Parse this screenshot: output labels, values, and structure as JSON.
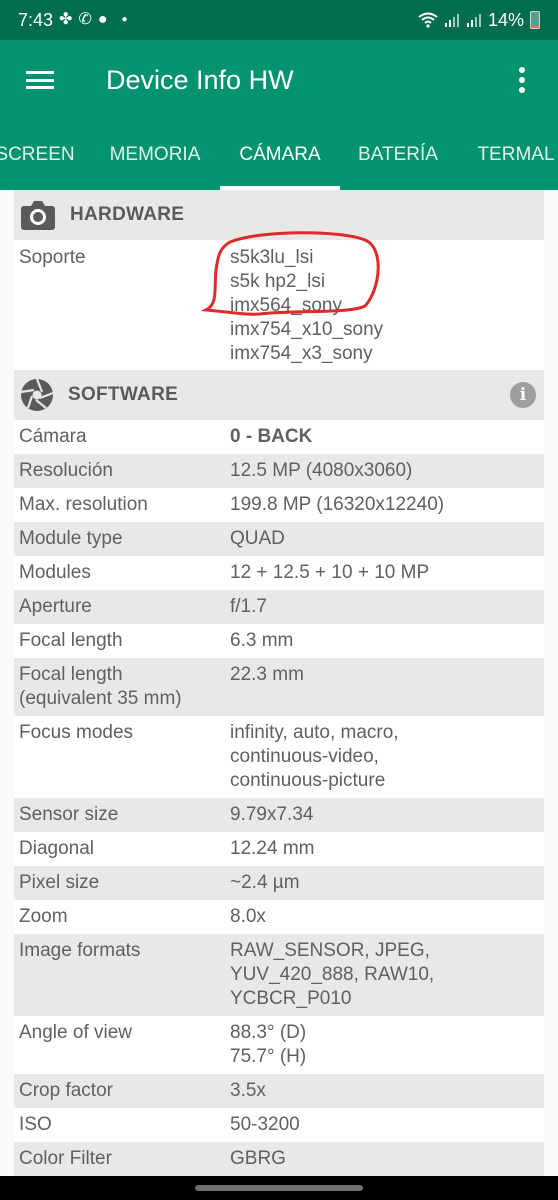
{
  "status_bar": {
    "time": "7:43",
    "notification_icons": [
      "pinwheel-icon",
      "whatsapp-icon",
      "bulb-icon",
      "dot-icon"
    ],
    "system_icons": [
      "wifi-icon",
      "signal-icon",
      "signal-icon"
    ],
    "battery_percent_text": "14%",
    "battery_level": 0.14
  },
  "app_bar": {
    "title": "Device Info HW",
    "menu_icon": "hamburger-menu-icon",
    "overflow_icon": "more-vert-icon"
  },
  "tabs": [
    {
      "label": "SCREEN",
      "active": false
    },
    {
      "label": "MEMORIA",
      "active": false
    },
    {
      "label": "CÁMARA",
      "active": true
    },
    {
      "label": "BATERÍA",
      "active": false
    },
    {
      "label": "TERMAL",
      "active": false
    }
  ],
  "hardware": {
    "header": "HARDWARE",
    "icon": "camera-icon",
    "rows": [
      {
        "key": "Soporte",
        "value": "s5k3lu_lsi\ns5k hp2_lsi\nimx564_sony\nimx754_x10_sony\nimx754_x3_sony"
      }
    ],
    "annotation": "red hand-drawn circle around first three sensor entries"
  },
  "software": {
    "header": "SOFTWARE",
    "icon": "aperture-icon",
    "info_icon": "info-icon",
    "rows": [
      {
        "key": "Cámara",
        "value": "0 - BACK",
        "bold": true
      },
      {
        "key": "Resolución",
        "value": "12.5 MP (4080x3060)"
      },
      {
        "key": "Max. resolution",
        "value": "199.8 MP (16320x12240)"
      },
      {
        "key": "Module type",
        "value": "QUAD"
      },
      {
        "key": "Modules",
        "value": "12 + 12.5 + 10 + 10 MP"
      },
      {
        "key": "Aperture",
        "value": "f/1.7"
      },
      {
        "key": "Focal length",
        "value": "6.3 mm"
      },
      {
        "key": "Focal length\n(equivalent 35 mm)",
        "value": "22.3 mm"
      },
      {
        "key": "Focus modes",
        "value": "infinity, auto, macro,\ncontinuous-video,\ncontinuous-picture"
      },
      {
        "key": "Sensor size",
        "value": "9.79x7.34"
      },
      {
        "key": "Diagonal",
        "value": "12.24 mm"
      },
      {
        "key": "Pixel size",
        "value": "~2.4 µm"
      },
      {
        "key": "Zoom",
        "value": "8.0x"
      },
      {
        "key": "Image formats",
        "value": "RAW_SENSOR, JPEG,\nYUV_420_888, RAW10,\nYCBCR_P010"
      },
      {
        "key": "Angle of view",
        "value": "88.3° (D)\n75.7° (H)"
      },
      {
        "key": "Crop factor",
        "value": "3.5x"
      },
      {
        "key": "ISO",
        "value": "50-3200"
      },
      {
        "key": "Color Filter",
        "value": "GBRG"
      }
    ]
  },
  "colors": {
    "status_bar": "#026c4f",
    "primary": "#039370",
    "annotation_red": "#e02a2a"
  }
}
